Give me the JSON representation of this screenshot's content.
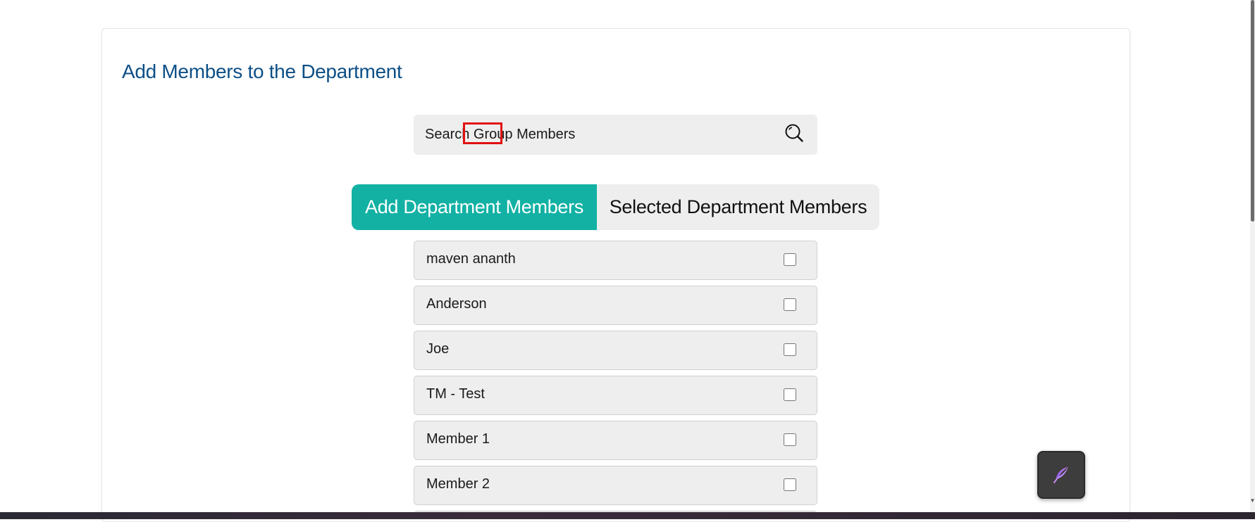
{
  "page": {
    "title": "Add Members to the Department"
  },
  "search": {
    "placeholder": "Search Group Members",
    "highlighted_word": "Group",
    "icon": "search-icon"
  },
  "tabs": [
    {
      "label": "Add Department Members",
      "active": true
    },
    {
      "label": "Selected Department Members",
      "active": false
    }
  ],
  "members": [
    {
      "name": "maven ananth",
      "checked": false
    },
    {
      "name": "Anderson",
      "checked": false
    },
    {
      "name": "Joe",
      "checked": false
    },
    {
      "name": "TM - Test",
      "checked": false
    },
    {
      "name": "Member 1",
      "checked": false
    },
    {
      "name": "Member 2",
      "checked": false
    }
  ],
  "fab": {
    "icon": "quill-pen-icon"
  },
  "colors": {
    "accent": "#12b1a4",
    "title": "#0d4f86",
    "highlight": "#e01010"
  }
}
